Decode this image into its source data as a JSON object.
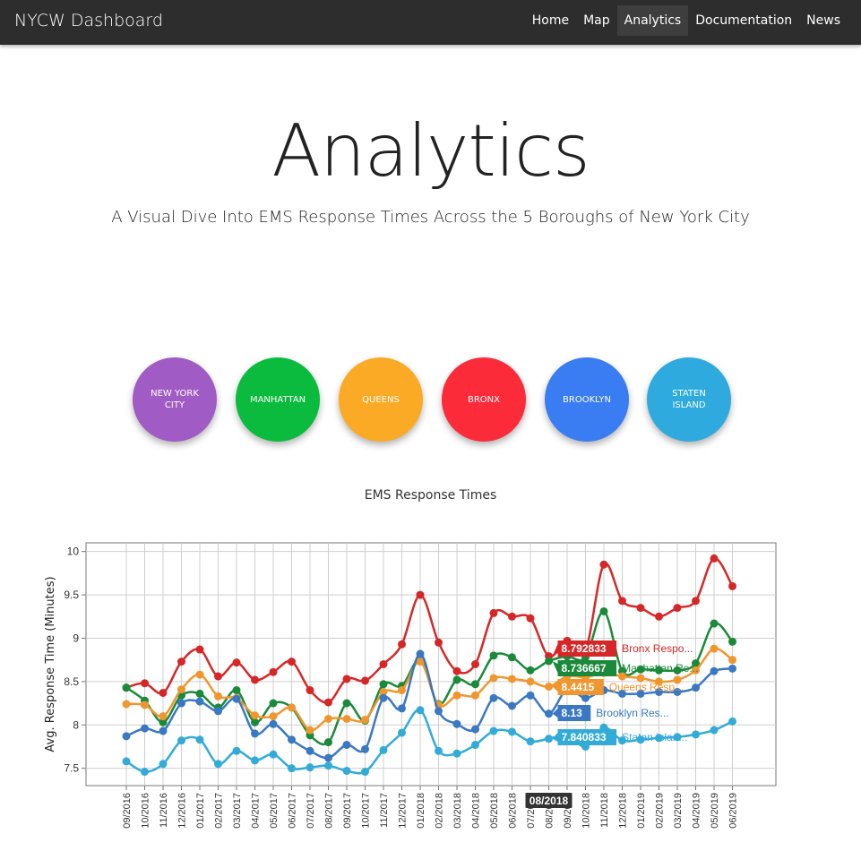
{
  "navbar": {
    "brand": "NYCW Dashboard",
    "links": [
      "Home",
      "Map",
      "Analytics",
      "Documentation",
      "News"
    ],
    "active": "Analytics"
  },
  "hero": {
    "title": "Analytics",
    "subtitle": "A Visual Dive Into EMS Response Times Across the 5 Boroughs of New York City"
  },
  "boroughs": [
    {
      "label": "NEW YORK CITY",
      "color": "#a05bc4"
    },
    {
      "label": "MANHATTAN",
      "color": "#0abb3e"
    },
    {
      "label": "QUEENS",
      "color": "#fbaa26"
    },
    {
      "label": "BRONX",
      "color": "#fc2b3a"
    },
    {
      "label": "BROOKLYN",
      "color": "#3a7cf1"
    },
    {
      "label": "STATEN ISLAND",
      "color": "#2eaade"
    }
  ],
  "chart_data": {
    "type": "line",
    "title": "EMS Response Times",
    "ylabel": "Avg. Response Time (Minutes)",
    "xlabel": "",
    "ylim": [
      7.3,
      10.1
    ],
    "yticks": [
      7.5,
      8,
      8.5,
      9,
      9.5,
      10
    ],
    "grid": true,
    "categories": [
      "09/2016",
      "10/2016",
      "11/2016",
      "12/2016",
      "01/2017",
      "02/2017",
      "03/2017",
      "04/2017",
      "05/2017",
      "06/2017",
      "07/2017",
      "08/2017",
      "09/2017",
      "10/2017",
      "11/2017",
      "12/2017",
      "01/2018",
      "02/2018",
      "03/2018",
      "04/2018",
      "05/2018",
      "06/2018",
      "07/2018",
      "08/2018",
      "09/2018",
      "10/2018",
      "11/2018",
      "12/2018",
      "01/2019",
      "02/2019",
      "03/2019",
      "04/2019",
      "05/2019",
      "06/2019"
    ],
    "series": [
      {
        "name": "Bronx Response Time",
        "color": "#d62728",
        "values": [
          8.43,
          8.48,
          8.37,
          8.73,
          8.87,
          8.56,
          8.72,
          8.52,
          8.61,
          8.73,
          8.4,
          8.26,
          8.53,
          8.51,
          8.7,
          8.93,
          9.5,
          8.95,
          8.62,
          8.7,
          9.29,
          9.25,
          9.23,
          8.792833,
          8.97,
          8.86,
          9.85,
          9.43,
          9.35,
          9.25,
          9.35,
          9.43,
          9.92,
          9.6
        ]
      },
      {
        "name": "Manhattan Response Time",
        "color": "#1a8a3a",
        "values": [
          8.43,
          8.28,
          8.03,
          8.34,
          8.36,
          8.2,
          8.4,
          8.03,
          8.25,
          8.2,
          7.88,
          7.8,
          8.25,
          8.05,
          8.47,
          8.45,
          8.75,
          8.24,
          8.52,
          8.47,
          8.8,
          8.78,
          8.63,
          8.736667,
          8.79,
          8.78,
          9.31,
          8.62,
          8.64,
          8.63,
          8.63,
          8.71,
          9.17,
          8.96
        ]
      },
      {
        "name": "Queens Response Time",
        "color": "#f0962e",
        "values": [
          8.24,
          8.23,
          8.1,
          8.41,
          8.58,
          8.33,
          8.31,
          8.11,
          8.1,
          8.2,
          7.94,
          8.07,
          8.07,
          8.06,
          8.38,
          8.4,
          8.73,
          8.23,
          8.34,
          8.34,
          8.54,
          8.53,
          8.5,
          8.4415,
          8.56,
          8.55,
          8.6,
          8.56,
          8.54,
          8.5,
          8.52,
          8.63,
          8.88,
          8.75
        ]
      },
      {
        "name": "Brooklyn Response Time",
        "color": "#3a78c2",
        "values": [
          7.87,
          7.96,
          7.93,
          8.25,
          8.27,
          8.16,
          8.3,
          7.9,
          8.01,
          7.83,
          7.7,
          7.62,
          7.77,
          7.72,
          8.31,
          8.19,
          8.82,
          8.16,
          8.01,
          7.95,
          8.31,
          8.22,
          8.34,
          8.13,
          8.41,
          8.31,
          8.4,
          8.36,
          8.36,
          8.38,
          8.38,
          8.43,
          8.62,
          8.65
        ]
      },
      {
        "name": "Staten Island Response Time",
        "color": "#33abd8",
        "values": [
          7.58,
          7.46,
          7.55,
          7.82,
          7.83,
          7.55,
          7.7,
          7.59,
          7.66,
          7.5,
          7.51,
          7.53,
          7.47,
          7.46,
          7.71,
          7.91,
          8.17,
          7.7,
          7.67,
          7.77,
          7.93,
          7.92,
          7.81,
          7.840833,
          7.88,
          7.75,
          7.97,
          7.82,
          7.83,
          7.85,
          7.86,
          7.89,
          7.94,
          8.04
        ]
      }
    ],
    "hover": {
      "category": "08/2018",
      "labels": [
        {
          "value": "8.792833",
          "name": "Bronx Respo..."
        },
        {
          "value": "8.736667",
          "name": "Manhattan Re..."
        },
        {
          "value": "8.4415",
          "name": "Queens Resp..."
        },
        {
          "value": "8.13",
          "name": "Brooklyn Res..."
        },
        {
          "value": "7.840833",
          "name": "Staten Islan..."
        }
      ]
    }
  }
}
